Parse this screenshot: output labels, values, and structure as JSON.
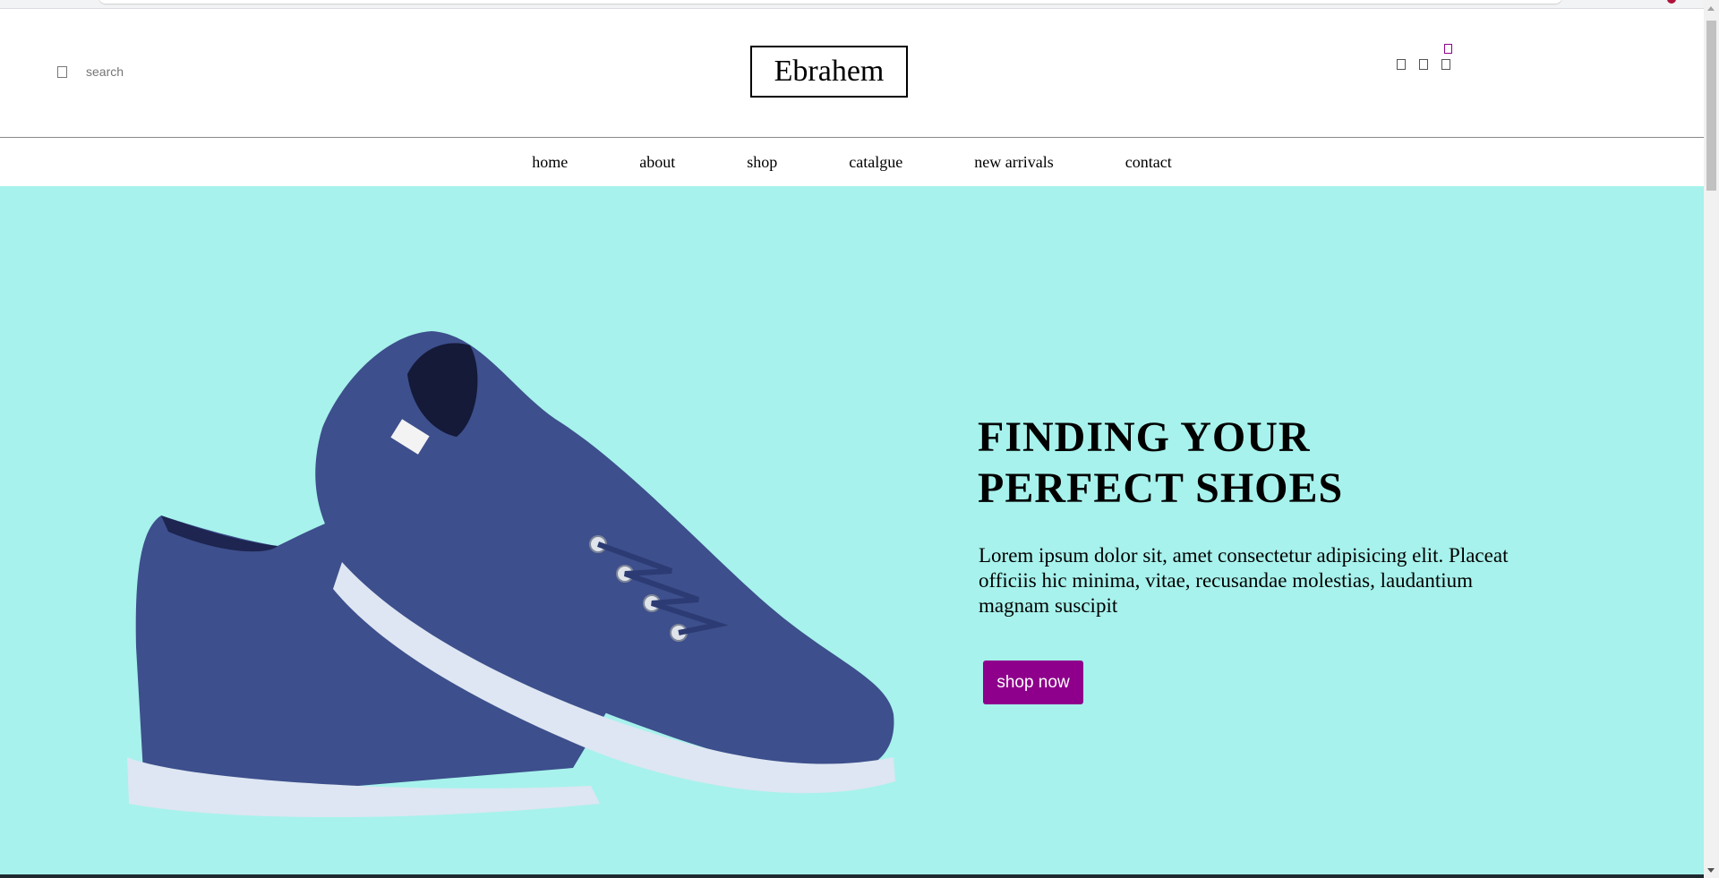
{
  "header": {
    "search_placeholder": "search",
    "logo": "Ebrahem",
    "icons": [
      "search-icon",
      "user-icon",
      "heart-icon",
      "cart-icon"
    ]
  },
  "nav": {
    "items": [
      "home",
      "about",
      "shop",
      "catalgue",
      "new arrivals",
      "contact"
    ]
  },
  "hero": {
    "title_line1": "FINDING YOUR",
    "title_line2": "PERFECT SHOES",
    "description": "Lorem ipsum dolor sit, amet consectetur adipisicing elit. Placeat officiis hic minima, vitae, recusandae molestias, laudantium magnam suscipit",
    "button": "shop now",
    "image": "blue-canvas-shoes"
  },
  "colors": {
    "hero_background": "#a7f2ec",
    "accent": "#8e008b",
    "shoe": "#3d4f8c"
  }
}
